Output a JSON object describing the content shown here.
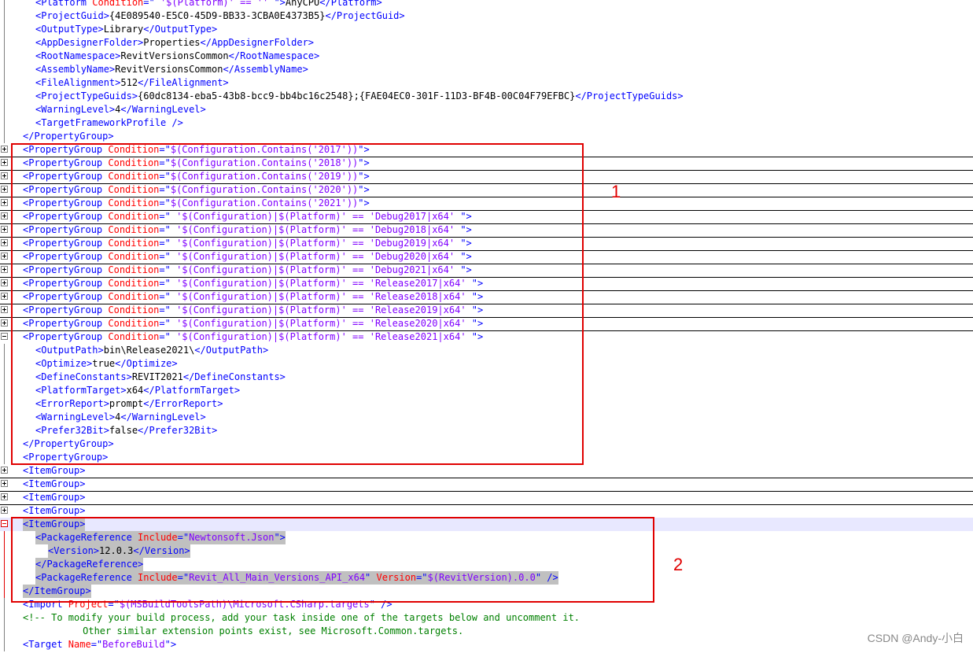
{
  "lines": [
    {
      "parts": [
        [
          "t",
          "<Platform "
        ],
        [
          "a",
          "Condition"
        ],
        [
          "t",
          "=\""
        ],
        [
          "v",
          " '$(Platform)' == '' "
        ],
        [
          "t",
          "\">"
        ],
        [
          "x",
          "AnyCPU"
        ],
        [
          "t",
          "</Platform>"
        ]
      ]
    },
    {
      "parts": [
        [
          "t",
          "<ProjectGuid>"
        ],
        [
          "x",
          "{4E089540-E5C0-45D9-BB33-3CBA0E4373B5}"
        ],
        [
          "t",
          "</ProjectGuid>"
        ]
      ]
    },
    {
      "parts": [
        [
          "t",
          "<OutputType>"
        ],
        [
          "x",
          "Library"
        ],
        [
          "t",
          "</OutputType>"
        ]
      ]
    },
    {
      "parts": [
        [
          "t",
          "<AppDesignerFolder>"
        ],
        [
          "x",
          "Properties"
        ],
        [
          "t",
          "</AppDesignerFolder>"
        ]
      ]
    },
    {
      "parts": [
        [
          "t",
          "<RootNamespace>"
        ],
        [
          "x",
          "RevitVersionsCommon"
        ],
        [
          "t",
          "</RootNamespace>"
        ]
      ]
    },
    {
      "parts": [
        [
          "t",
          "<AssemblyName>"
        ],
        [
          "x",
          "RevitVersionsCommon"
        ],
        [
          "t",
          "</AssemblyName>"
        ]
      ]
    },
    {
      "parts": [
        [
          "t",
          "<FileAlignment>"
        ],
        [
          "x",
          "512"
        ],
        [
          "t",
          "</FileAlignment>"
        ]
      ]
    },
    {
      "parts": [
        [
          "t",
          "<ProjectTypeGuids>"
        ],
        [
          "x",
          "{60dc8134-eba5-43b8-bcc9-bb4bc16c2548};{FAE04EC0-301F-11D3-BF4B-00C04F79EFBC}"
        ],
        [
          "t",
          "</ProjectTypeGuids>"
        ]
      ]
    },
    {
      "parts": [
        [
          "t",
          "<WarningLevel>"
        ],
        [
          "x",
          "4"
        ],
        [
          "t",
          "</WarningLevel>"
        ]
      ]
    },
    {
      "parts": [
        [
          "t",
          "<TargetFrameworkProfile />"
        ]
      ]
    },
    {
      "parts": [
        [
          "t",
          "</PropertyGroup>"
        ]
      ]
    },
    {
      "parts": [
        [
          "t",
          "<PropertyGroup "
        ],
        [
          "a",
          "Condition"
        ],
        [
          "t",
          "=\""
        ],
        [
          "v",
          "$(Configuration.Contains('2017'))"
        ],
        [
          "t",
          "\">"
        ]
      ]
    },
    {
      "parts": [
        [
          "t",
          "<PropertyGroup "
        ],
        [
          "a",
          "Condition"
        ],
        [
          "t",
          "=\""
        ],
        [
          "v",
          "$(Configuration.Contains('2018'))"
        ],
        [
          "t",
          "\">"
        ]
      ]
    },
    {
      "parts": [
        [
          "t",
          "<PropertyGroup "
        ],
        [
          "a",
          "Condition"
        ],
        [
          "t",
          "=\""
        ],
        [
          "v",
          "$(Configuration.Contains('2019'))"
        ],
        [
          "t",
          "\">"
        ]
      ]
    },
    {
      "parts": [
        [
          "t",
          "<PropertyGroup "
        ],
        [
          "a",
          "Condition"
        ],
        [
          "t",
          "=\""
        ],
        [
          "v",
          "$(Configuration.Contains('2020'))"
        ],
        [
          "t",
          "\">"
        ]
      ]
    },
    {
      "parts": [
        [
          "t",
          "<PropertyGroup "
        ],
        [
          "a",
          "Condition"
        ],
        [
          "t",
          "=\""
        ],
        [
          "v",
          "$(Configuration.Contains('2021'))"
        ],
        [
          "t",
          "\">"
        ]
      ]
    },
    {
      "parts": [
        [
          "t",
          "<PropertyGroup "
        ],
        [
          "a",
          "Condition"
        ],
        [
          "t",
          "=\""
        ],
        [
          "v",
          " '$(Configuration)|$(Platform)' == 'Debug2017|x64' "
        ],
        [
          "t",
          "\">"
        ]
      ]
    },
    {
      "parts": [
        [
          "t",
          "<PropertyGroup "
        ],
        [
          "a",
          "Condition"
        ],
        [
          "t",
          "=\""
        ],
        [
          "v",
          " '$(Configuration)|$(Platform)' == 'Debug2018|x64' "
        ],
        [
          "t",
          "\">"
        ]
      ]
    },
    {
      "parts": [
        [
          "t",
          "<PropertyGroup "
        ],
        [
          "a",
          "Condition"
        ],
        [
          "t",
          "=\""
        ],
        [
          "v",
          " '$(Configuration)|$(Platform)' == 'Debug2019|x64' "
        ],
        [
          "t",
          "\">"
        ]
      ]
    },
    {
      "parts": [
        [
          "t",
          "<PropertyGroup "
        ],
        [
          "a",
          "Condition"
        ],
        [
          "t",
          "=\""
        ],
        [
          "v",
          " '$(Configuration)|$(Platform)' == 'Debug2020|x64' "
        ],
        [
          "t",
          "\">"
        ]
      ]
    },
    {
      "parts": [
        [
          "t",
          "<PropertyGroup "
        ],
        [
          "a",
          "Condition"
        ],
        [
          "t",
          "=\""
        ],
        [
          "v",
          " '$(Configuration)|$(Platform)' == 'Debug2021|x64' "
        ],
        [
          "t",
          "\">"
        ]
      ]
    },
    {
      "parts": [
        [
          "t",
          "<PropertyGroup "
        ],
        [
          "a",
          "Condition"
        ],
        [
          "t",
          "=\""
        ],
        [
          "v",
          " '$(Configuration)|$(Platform)' == 'Release2017|x64' "
        ],
        [
          "t",
          "\">"
        ]
      ]
    },
    {
      "parts": [
        [
          "t",
          "<PropertyGroup "
        ],
        [
          "a",
          "Condition"
        ],
        [
          "t",
          "=\""
        ],
        [
          "v",
          " '$(Configuration)|$(Platform)' == 'Release2018|x64' "
        ],
        [
          "t",
          "\">"
        ]
      ]
    },
    {
      "parts": [
        [
          "t",
          "<PropertyGroup "
        ],
        [
          "a",
          "Condition"
        ],
        [
          "t",
          "=\""
        ],
        [
          "v",
          " '$(Configuration)|$(Platform)' == 'Release2019|x64' "
        ],
        [
          "t",
          "\">"
        ]
      ]
    },
    {
      "parts": [
        [
          "t",
          "<PropertyGroup "
        ],
        [
          "a",
          "Condition"
        ],
        [
          "t",
          "=\""
        ],
        [
          "v",
          " '$(Configuration)|$(Platform)' == 'Release2020|x64' "
        ],
        [
          "t",
          "\">"
        ]
      ]
    },
    {
      "parts": [
        [
          "t",
          "<PropertyGroup "
        ],
        [
          "a",
          "Condition"
        ],
        [
          "t",
          "=\""
        ],
        [
          "v",
          " '$(Configuration)|$(Platform)' == 'Release2021|x64' "
        ],
        [
          "t",
          "\">"
        ]
      ]
    },
    {
      "parts": [
        [
          "t",
          "<OutputPath>"
        ],
        [
          "x",
          "bin\\Release2021\\"
        ],
        [
          "t",
          "</OutputPath>"
        ]
      ]
    },
    {
      "parts": [
        [
          "t",
          "<Optimize>"
        ],
        [
          "x",
          "true"
        ],
        [
          "t",
          "</Optimize>"
        ]
      ]
    },
    {
      "parts": [
        [
          "t",
          "<DefineConstants>"
        ],
        [
          "x",
          "REVIT2021"
        ],
        [
          "t",
          "</DefineConstants>"
        ]
      ]
    },
    {
      "parts": [
        [
          "t",
          "<PlatformTarget>"
        ],
        [
          "x",
          "x64"
        ],
        [
          "t",
          "</PlatformTarget>"
        ]
      ]
    },
    {
      "parts": [
        [
          "t",
          "<ErrorReport>"
        ],
        [
          "x",
          "prompt"
        ],
        [
          "t",
          "</ErrorReport>"
        ]
      ]
    },
    {
      "parts": [
        [
          "t",
          "<WarningLevel>"
        ],
        [
          "x",
          "4"
        ],
        [
          "t",
          "</WarningLevel>"
        ]
      ]
    },
    {
      "parts": [
        [
          "t",
          "<Prefer32Bit>"
        ],
        [
          "x",
          "false"
        ],
        [
          "t",
          "</Prefer32Bit>"
        ]
      ]
    },
    {
      "parts": [
        [
          "t",
          "</PropertyGroup>"
        ]
      ]
    },
    {
      "parts": [
        [
          "t",
          "<PropertyGroup>"
        ]
      ]
    },
    {
      "parts": [
        [
          "t",
          "<ItemGroup>"
        ]
      ]
    },
    {
      "parts": [
        [
          "t",
          "<ItemGroup>"
        ]
      ]
    },
    {
      "parts": [
        [
          "t",
          "<ItemGroup>"
        ]
      ]
    },
    {
      "parts": [
        [
          "t",
          "<ItemGroup>"
        ]
      ]
    },
    {
      "parts": [
        [
          "t",
          "<ItemGroup>"
        ]
      ]
    },
    {
      "parts": [
        [
          "t",
          "<PackageReference "
        ],
        [
          "a",
          "Include"
        ],
        [
          "t",
          "=\""
        ],
        [
          "v",
          "Newtonsoft.Json"
        ],
        [
          "t",
          "\">"
        ]
      ]
    },
    {
      "parts": [
        [
          "t",
          "<Version>"
        ],
        [
          "x",
          "12.0.3"
        ],
        [
          "t",
          "</Version>"
        ]
      ]
    },
    {
      "parts": [
        [
          "t",
          "</PackageReference>"
        ]
      ]
    },
    {
      "parts": [
        [
          "t",
          "<PackageReference "
        ],
        [
          "a",
          "Include"
        ],
        [
          "t",
          "=\""
        ],
        [
          "v",
          "Revit_All_Main_Versions_API_x64"
        ],
        [
          "t",
          "\" "
        ],
        [
          "a",
          "Version"
        ],
        [
          "t",
          "=\""
        ],
        [
          "v",
          "$(RevitVersion).0.0"
        ],
        [
          "t",
          "\" />"
        ]
      ]
    },
    {
      "parts": [
        [
          "t",
          "</ItemGroup>"
        ]
      ]
    },
    {
      "parts": [
        [
          "t",
          "<Import "
        ],
        [
          "a",
          "Project"
        ],
        [
          "t",
          "=\""
        ],
        [
          "v",
          "$(MSBuildToolsPath)\\Microsoft.CSharp.targets"
        ],
        [
          "t",
          "\" />"
        ]
      ]
    },
    {
      "parts": [
        [
          "c",
          "<!-- To modify your build process, add your task inside one of the targets below and uncomment it."
        ]
      ]
    },
    {
      "parts": [
        [
          "c",
          "     Other similar extension points exist, see Microsoft.Common.targets."
        ]
      ]
    },
    {
      "parts": [
        [
          "t",
          "<Target "
        ],
        [
          "a",
          "Name"
        ],
        [
          "t",
          "=\""
        ],
        [
          "v",
          "BeforeBuild"
        ],
        [
          "t",
          "\">"
        ]
      ]
    }
  ],
  "annotations": {
    "box1_label": "1",
    "box2_label": "2"
  },
  "watermark": "CSDN @Andy-小白",
  "colors": {
    "tag": "#0000ff",
    "attr": "#ff0000",
    "value": "#8000ff",
    "text": "#000000",
    "comment": "#008000",
    "highlight": "#c0c0c0",
    "annotation": "#e00000"
  }
}
